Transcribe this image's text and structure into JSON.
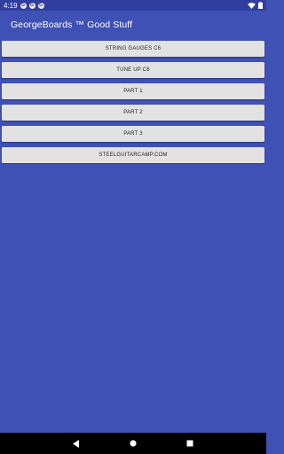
{
  "status_bar": {
    "time": "4:19",
    "app_icons": [
      "G",
      "G",
      "G"
    ]
  },
  "app": {
    "title": "GeorgeBoards ™ Good Stuff"
  },
  "buttons": [
    {
      "label": "STRING GAUGES C6"
    },
    {
      "label": "TUNE UP C6"
    },
    {
      "label": "PART 1"
    },
    {
      "label": "PART 2"
    },
    {
      "label": "PART 3"
    },
    {
      "label": "STEELGUITARCAMP.COM"
    }
  ],
  "colors": {
    "primary": "#3F51B5",
    "primary_dark": "#303F9F",
    "button": "#E2E2E2",
    "nav": "#000000"
  },
  "icons": {
    "wifi": "wifi-icon",
    "battery": "battery-icon",
    "back": "back-icon",
    "home": "home-icon",
    "recents": "recents-icon"
  }
}
